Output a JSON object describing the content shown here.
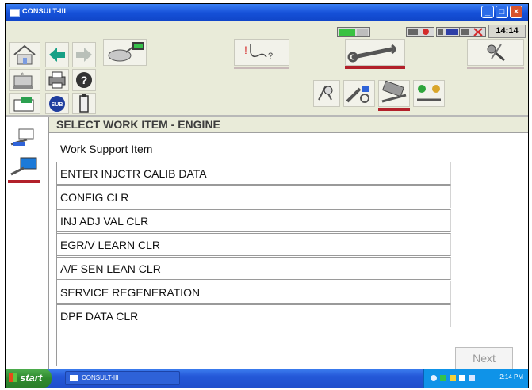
{
  "window": {
    "title": "CONSULT-III",
    "minimize_icon": "minimize-icon",
    "maximize_icon": "maximize-icon",
    "close_icon": "close-icon"
  },
  "status_bar": {
    "clock": "14:14"
  },
  "toolbar": {
    "nav_icons": [
      "home-icon",
      "back-arrow-icon",
      "forward-arrow-icon",
      "vehicle-interface-icon",
      "printer-icon",
      "help-icon",
      "screen-capture-icon",
      "sub-mode-icon",
      "battery-icon"
    ],
    "mode_icons": [
      "diagnosis-icon",
      "repair-wrench-icon",
      "settings-tools-icon"
    ],
    "sub_icons": [
      "search-part-icon",
      "data-monitor-icon",
      "work-support-icon",
      "active-test-icon"
    ],
    "sub_mode_label": "SUB"
  },
  "sidebar": {
    "items": [
      "connection-icon",
      "vi-device-icon"
    ]
  },
  "page": {
    "title": "SELECT WORK ITEM - ENGINE",
    "section_label": "Work Support Item",
    "items": [
      "ENTER INJCTR CALIB DATA",
      "CONFIG CLR",
      "INJ ADJ VAL CLR",
      "EGR/V LEARN CLR",
      "A/F SEN LEAN CLR",
      "SERVICE REGENERATION",
      "DPF DATA CLR"
    ],
    "next_label": "Next"
  },
  "taskbar": {
    "start_label": "start",
    "task_label": "CONSULT-III",
    "tray_time": "2:14 PM"
  },
  "colors": {
    "accent_red": "#b2202a",
    "titlebar_blue": "#1550d8",
    "panel_bg": "#e9ebd9"
  }
}
